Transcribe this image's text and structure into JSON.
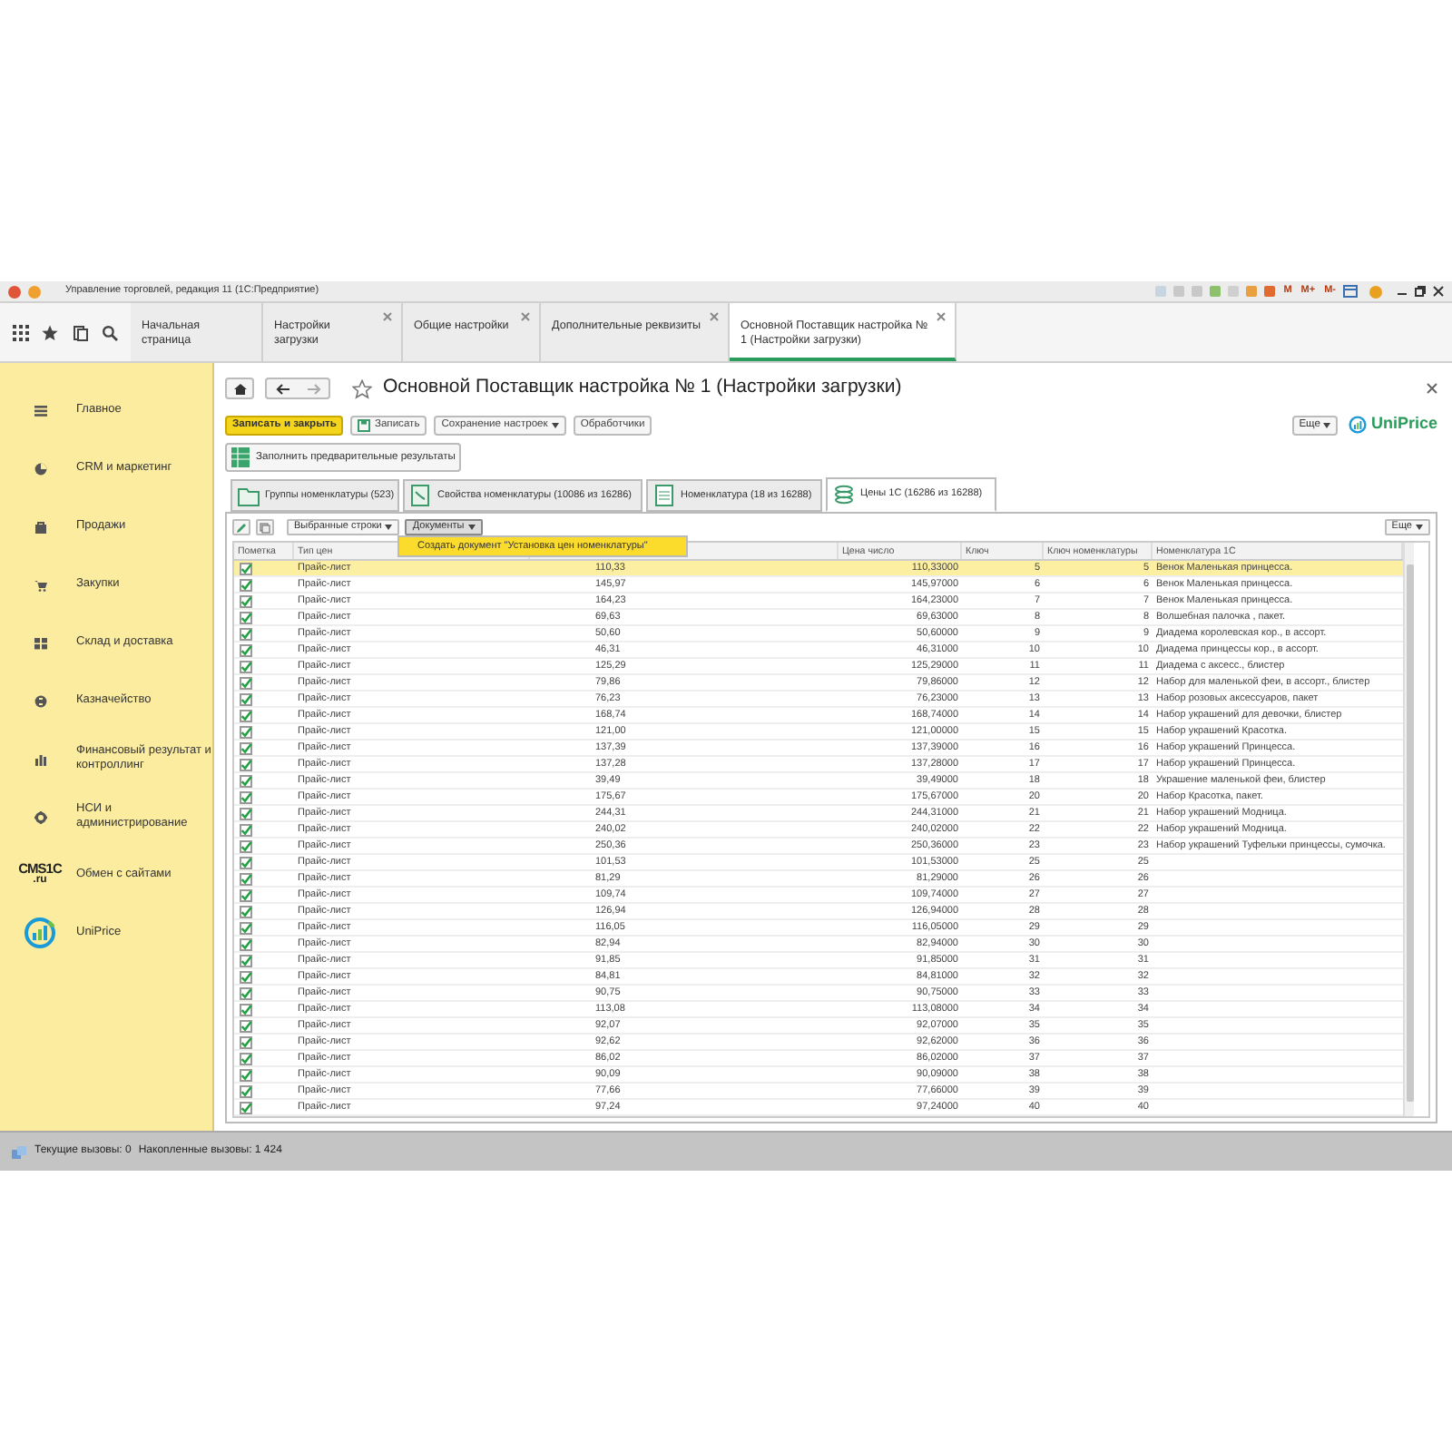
{
  "window": {
    "title": "Управление торговлей, редакция 11  (1С:Предприятие)",
    "memory_buttons": [
      "M",
      "M+",
      "M-"
    ]
  },
  "tabs": [
    {
      "label": "Начальная страница",
      "selected": false,
      "closable": false
    },
    {
      "label": "Настройки загрузки",
      "selected": false,
      "closable": true
    },
    {
      "label": "Общие настройки",
      "selected": false,
      "closable": true
    },
    {
      "label": "Дополнительные реквизиты",
      "selected": false,
      "closable": true
    },
    {
      "label": "Основной Поставщик настройка № 1 (Настройки загрузки)",
      "selected": true,
      "closable": true
    }
  ],
  "sidebar": {
    "items": [
      {
        "label": "Главное",
        "kind": "icon"
      },
      {
        "label": "CRM и маркетинг",
        "kind": "icon"
      },
      {
        "label": "Продажи",
        "kind": "icon"
      },
      {
        "label": "Закупки",
        "kind": "icon"
      },
      {
        "label": "Склад и доставка",
        "kind": "icon"
      },
      {
        "label": "Казначейство",
        "kind": "icon"
      },
      {
        "label": "Финансовый результат и контроллинг",
        "kind": "icon"
      },
      {
        "label": "НСИ и администрирование",
        "kind": "icon"
      },
      {
        "label": "Обмен с сайтами",
        "kind": "text_logo",
        "logo_lines": [
          "CMS1C",
          ".ru"
        ]
      },
      {
        "label": "UniPrice",
        "kind": "graphic_logo"
      }
    ]
  },
  "form": {
    "title": "Основной Поставщик настройка № 1 (Настройки загрузки)",
    "buttons": [
      {
        "label": "Записать и закрыть",
        "kind": "primary"
      },
      {
        "label": "Записать",
        "kind": "icon"
      },
      {
        "label": "Сохранение настроек",
        "kind": "dropdown"
      },
      {
        "label": "Обработчики",
        "kind": "plain"
      }
    ],
    "more_button": "Еще",
    "brand": "UniPrice",
    "fill_button": "Заполнить предварительные результаты",
    "tabs": [
      {
        "label": "Группы номенклатуры (523)",
        "selected": false
      },
      {
        "label": "Свойства номенклатуры (10086 из 16286)",
        "selected": false
      },
      {
        "label": "Номенклатура (18 из 16288)",
        "selected": false
      },
      {
        "label": "Цены 1С (16286 из 16288)",
        "selected": true
      }
    ],
    "table_toolbar": {
      "buttons": [
        {
          "label": "Выбранные строки",
          "pressed": false
        },
        {
          "label": "Документы",
          "pressed": true
        }
      ],
      "more_button": "Еще"
    },
    "popup_menu": {
      "items": [
        {
          "label": "Создать документ \"Установка цен номенклатуры\"",
          "selected": true
        }
      ]
    },
    "table": {
      "mark_column": {
        "label": "Пометка"
      },
      "columns": [
        {
          "label": "Тип цен"
        },
        {},
        {
          "label": "Цена число"
        },
        {
          "label": "Ключ"
        },
        {
          "label": "Ключ номенклатуры"
        },
        {
          "label": "Номенклатура 1С"
        }
      ],
      "rows": [
        {
          "checked": true,
          "selected": true,
          "cells": [
            "Прайс-лист",
            "110,33",
            "110,33000",
            "5",
            "5",
            "Венок Маленькая принцесса."
          ]
        },
        {
          "checked": true,
          "selected": false,
          "cells": [
            "Прайс-лист",
            "145,97",
            "145,97000",
            "6",
            "6",
            "Венок Маленькая принцесса."
          ]
        },
        {
          "checked": true,
          "selected": false,
          "cells": [
            "Прайс-лист",
            "164,23",
            "164,23000",
            "7",
            "7",
            "Венок Маленькая принцесса."
          ]
        },
        {
          "checked": true,
          "selected": false,
          "cells": [
            "Прайс-лист",
            "69,63",
            "69,63000",
            "8",
            "8",
            "Волшебная палочка , пакет."
          ]
        },
        {
          "checked": true,
          "selected": false,
          "cells": [
            "Прайс-лист",
            "50,60",
            "50,60000",
            "9",
            "9",
            "Диадема королевская кор., в ассорт."
          ]
        },
        {
          "checked": true,
          "selected": false,
          "cells": [
            "Прайс-лист",
            "46,31",
            "46,31000",
            "10",
            "10",
            "Диадема принцессы кор., в ассорт."
          ]
        },
        {
          "checked": true,
          "selected": false,
          "cells": [
            "Прайс-лист",
            "125,29",
            "125,29000",
            "11",
            "11",
            "Диадема с аксесс., блистер"
          ]
        },
        {
          "checked": true,
          "selected": false,
          "cells": [
            "Прайс-лист",
            "79,86",
            "79,86000",
            "12",
            "12",
            "Набор для маленькой феи, в ассорт., блистер"
          ]
        },
        {
          "checked": true,
          "selected": false,
          "cells": [
            "Прайс-лист",
            "76,23",
            "76,23000",
            "13",
            "13",
            "Набор розовых аксессуаров, пакет"
          ]
        },
        {
          "checked": true,
          "selected": false,
          "cells": [
            "Прайс-лист",
            "168,74",
            "168,74000",
            "14",
            "14",
            "Набор украшений для девочки, блистер"
          ]
        },
        {
          "checked": true,
          "selected": false,
          "cells": [
            "Прайс-лист",
            "121,00",
            "121,00000",
            "15",
            "15",
            "Набор украшений Красотка."
          ]
        },
        {
          "checked": true,
          "selected": false,
          "cells": [
            "Прайс-лист",
            "137,39",
            "137,39000",
            "16",
            "16",
            "Набор украшений Принцесса."
          ]
        },
        {
          "checked": true,
          "selected": false,
          "cells": [
            "Прайс-лист",
            "137,28",
            "137,28000",
            "17",
            "17",
            "Набор украшений Принцесса."
          ]
        },
        {
          "checked": true,
          "selected": false,
          "cells": [
            "Прайс-лист",
            "39,49",
            "39,49000",
            "18",
            "18",
            "Украшение маленькой феи, блистер"
          ]
        },
        {
          "checked": true,
          "selected": false,
          "cells": [
            "Прайс-лист",
            "175,67",
            "175,67000",
            "20",
            "20",
            "Набор Красотка, пакет."
          ]
        },
        {
          "checked": true,
          "selected": false,
          "cells": [
            "Прайс-лист",
            "244,31",
            "244,31000",
            "21",
            "21",
            "Набор украшений Модница."
          ]
        },
        {
          "checked": true,
          "selected": false,
          "cells": [
            "Прайс-лист",
            "240,02",
            "240,02000",
            "22",
            "22",
            "Набор украшений Модница."
          ]
        },
        {
          "checked": true,
          "selected": false,
          "cells": [
            "Прайс-лист",
            "250,36",
            "250,36000",
            "23",
            "23",
            "Набор украшений Туфельки принцессы, сумочка."
          ]
        },
        {
          "checked": true,
          "selected": false,
          "cells": [
            "Прайс-лист",
            "101,53",
            "101,53000",
            "25",
            "25"
          ]
        },
        {
          "checked": true,
          "selected": false,
          "cells": [
            "Прайс-лист",
            "81,29",
            "81,29000",
            "26",
            "26"
          ]
        },
        {
          "checked": true,
          "selected": false,
          "cells": [
            "Прайс-лист",
            "109,74",
            "109,74000",
            "27",
            "27"
          ]
        },
        {
          "checked": true,
          "selected": false,
          "cells": [
            "Прайс-лист",
            "126,94",
            "126,94000",
            "28",
            "28"
          ]
        },
        {
          "checked": true,
          "selected": false,
          "cells": [
            "Прайс-лист",
            "116,05",
            "116,05000",
            "29",
            "29"
          ]
        },
        {
          "checked": true,
          "selected": false,
          "cells": [
            "Прайс-лист",
            "82,94",
            "82,94000",
            "30",
            "30"
          ]
        },
        {
          "checked": true,
          "selected": false,
          "cells": [
            "Прайс-лист",
            "91,85",
            "91,85000",
            "31",
            "31"
          ]
        },
        {
          "checked": true,
          "selected": false,
          "cells": [
            "Прайс-лист",
            "84,81",
            "84,81000",
            "32",
            "32"
          ]
        },
        {
          "checked": true,
          "selected": false,
          "cells": [
            "Прайс-лист",
            "90,75",
            "90,75000",
            "33",
            "33"
          ]
        },
        {
          "checked": true,
          "selected": false,
          "cells": [
            "Прайс-лист",
            "113,08",
            "113,08000",
            "34",
            "34"
          ]
        },
        {
          "checked": true,
          "selected": false,
          "cells": [
            "Прайс-лист",
            "92,07",
            "92,07000",
            "35",
            "35"
          ]
        },
        {
          "checked": true,
          "selected": false,
          "cells": [
            "Прайс-лист",
            "92,62",
            "92,62000",
            "36",
            "36"
          ]
        },
        {
          "checked": true,
          "selected": false,
          "cells": [
            "Прайс-лист",
            "86,02",
            "86,02000",
            "37",
            "37"
          ]
        },
        {
          "checked": true,
          "selected": false,
          "cells": [
            "Прайс-лист",
            "90,09",
            "90,09000",
            "38",
            "38"
          ]
        },
        {
          "checked": true,
          "selected": false,
          "cells": [
            "Прайс-лист",
            "77,66",
            "77,66000",
            "39",
            "39"
          ]
        },
        {
          "checked": true,
          "selected": false,
          "cells": [
            "Прайс-лист",
            "97,24",
            "97,24000",
            "40",
            "40"
          ]
        }
      ]
    }
  },
  "status_bar": {
    "items": [
      "Текущие вызовы: 0",
      "Накопленные вызовы: 1 424"
    ]
  }
}
